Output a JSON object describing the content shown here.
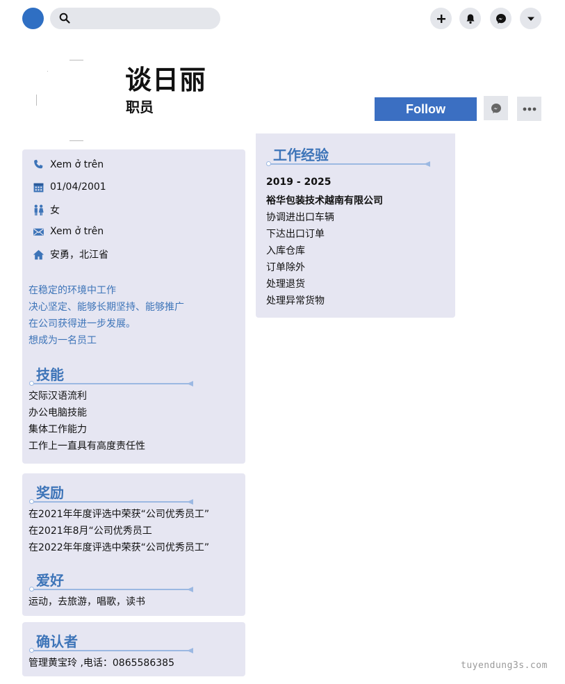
{
  "header": {
    "name": "谈日丽",
    "role": "职员",
    "follow_label": "Follow"
  },
  "icons": {
    "search": "search-icon",
    "plus": "plus-icon",
    "bell": "bell-icon",
    "messenger": "messenger-icon",
    "caret": "caret-down-icon",
    "more": "more-icon"
  },
  "colors": {
    "accent": "#3b6fc2",
    "panel_bg": "#e6e6f2",
    "section_title": "#3d74b8"
  },
  "contact": {
    "phone": "Xem ở trên",
    "birthday": "01/04/2001",
    "gender": "女",
    "email": "Xem ở trên",
    "address": "安勇，北江省"
  },
  "objective": [
    "在稳定的环境中工作",
    "决心坚定、能够长期坚持、能够推广",
    "在公司获得进一步发展。",
    "想成为一名员工"
  ],
  "skills": {
    "title": "技能",
    "items": [
      "交际汉语流利",
      "办公电脑技能",
      "集体工作能力",
      "工作上一直具有高度责任性"
    ]
  },
  "awards": {
    "title": "奖励",
    "items": [
      "在2021年年度评选中荣获“公司优秀员工”",
      "在2021年8月“公司优秀员工",
      "在2022年年度评选中荣获“公司优秀员工”"
    ]
  },
  "hobbies": {
    "title": "爱好",
    "text": "运动，去旅游，唱歌，读书"
  },
  "reference": {
    "title": "确认者",
    "text": "管理黄宝玲 ,电话：0865586385"
  },
  "experience": {
    "title": "工作经验",
    "period": "2019 - 2025",
    "company": "裕华包装技术越南有限公司",
    "duties": [
      "协调进出口车辆",
      "下达出口订单",
      "入库仓库",
      "订单除外",
      "处理退货",
      "处理异常货物"
    ]
  },
  "watermark": "tuyendung3s.com"
}
